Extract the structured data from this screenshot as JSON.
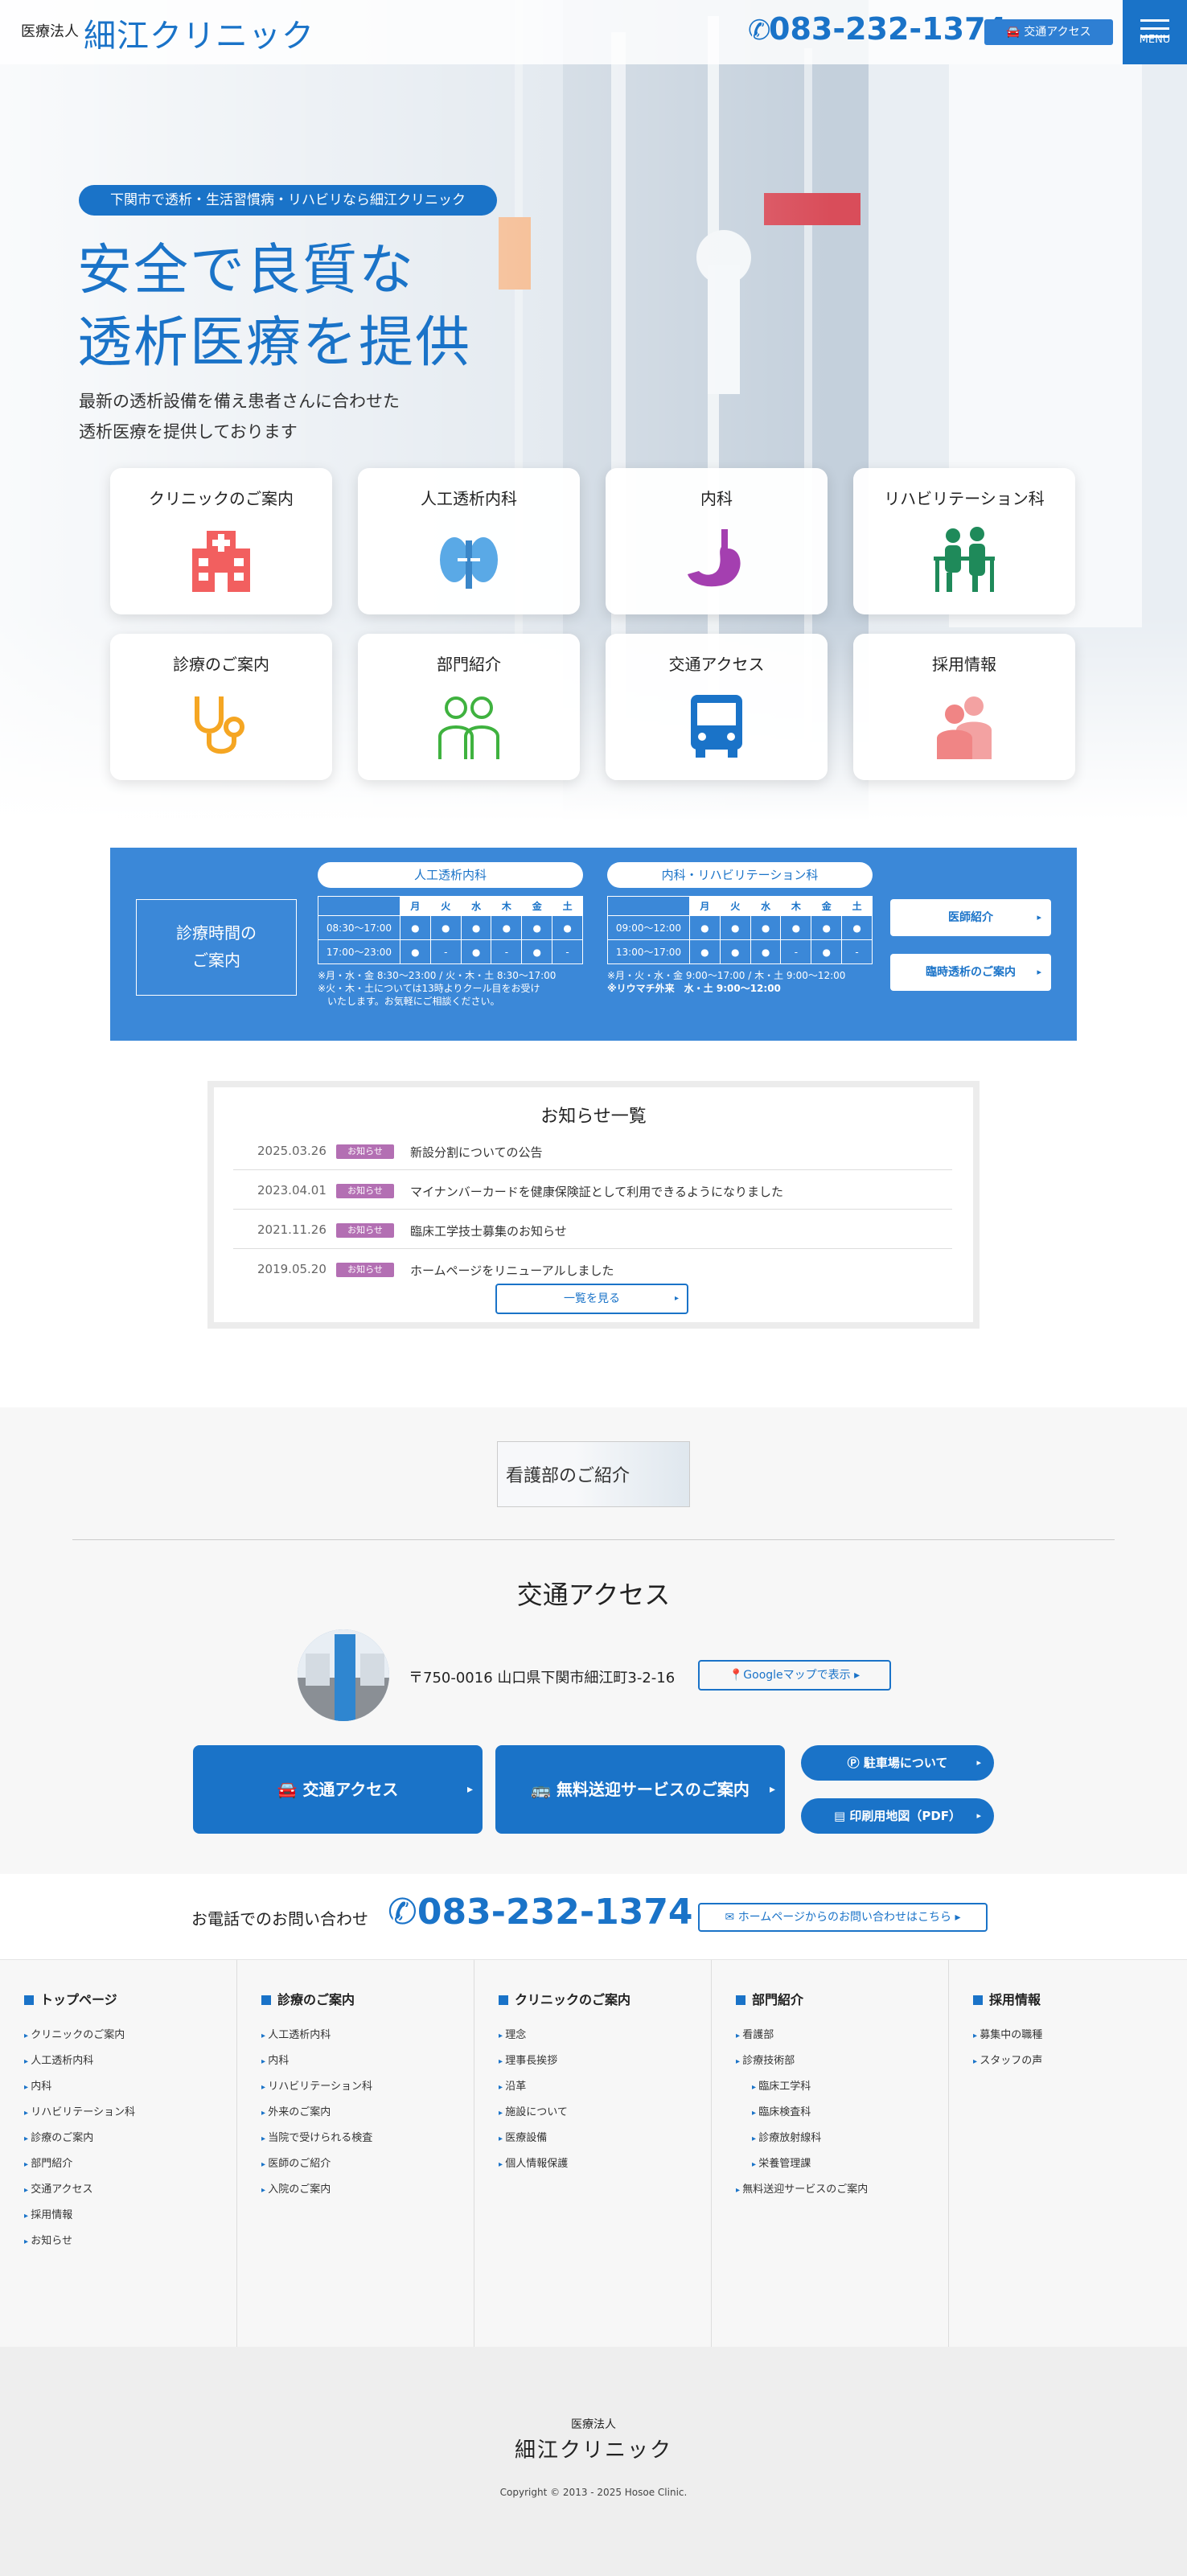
{
  "header": {
    "org_type": "医療法人",
    "clinic_name": "細江クリニック",
    "phone": "083-232-1374",
    "access_label": "交通アクセス",
    "menu_label": "MENU"
  },
  "hero": {
    "tag": "下関市で透析・生活習慣病・リハビリなら細江クリニック",
    "title_line1": "安全で良質な",
    "title_line2": "透析医療を提供",
    "sub_line1": "最新の透析設備を備え患者さんに合わせた",
    "sub_line2": "透析医療を提供しております"
  },
  "tiles": [
    {
      "label": "クリニックのご案内",
      "icon": "hospital-icon"
    },
    {
      "label": "人工透析内科",
      "icon": "kidney-icon"
    },
    {
      "label": "内科",
      "icon": "stomach-icon"
    },
    {
      "label": "リハビリテーション科",
      "icon": "rehabilitation-icon"
    },
    {
      "label": "診療のご案内",
      "icon": "stethoscope-icon"
    },
    {
      "label": "部門紹介",
      "icon": "staff-icon"
    },
    {
      "label": "交通アクセス",
      "icon": "bus-icon"
    },
    {
      "label": "採用情報",
      "icon": "recruit-icon"
    }
  ],
  "schedule": {
    "title_line1": "診療時間の",
    "title_line2": "ご案内",
    "days": [
      "月",
      "火",
      "水",
      "木",
      "金",
      "土"
    ],
    "dialysis": {
      "label": "人工透析内科",
      "rows": [
        {
          "time": "08:30〜17:00",
          "cells": [
            "●",
            "●",
            "●",
            "●",
            "●",
            "●"
          ]
        },
        {
          "time": "17:00〜23:00",
          "cells": [
            "●",
            "-",
            "●",
            "-",
            "●",
            "-"
          ]
        }
      ],
      "note1": "※月・水・金 8:30〜23:00 / 火・木・土 8:30〜17:00",
      "note2": "※火・木・土については13時よりクール目をお受け",
      "note3": "　いたします。お気軽にご相談ください。"
    },
    "internal": {
      "label": "内科・リハビリテーション科",
      "rows": [
        {
          "time": "09:00〜12:00",
          "cells": [
            "●",
            "●",
            "●",
            "●",
            "●",
            "●"
          ]
        },
        {
          "time": "13:00〜17:00",
          "cells": [
            "●",
            "●",
            "●",
            "-",
            "●",
            "-"
          ]
        }
      ],
      "note1": "※月・火・水・金 9:00〜17:00 / 木・土 9:00〜12:00",
      "note2": "※リウマチ外来　水・土 9:00〜12:00"
    },
    "btn_doctor": "医師紹介",
    "btn_temp": "臨時透析のご案内"
  },
  "news": {
    "title": "お知らせ一覧",
    "badge": "お知らせ",
    "items": [
      {
        "date": "2025.03.26",
        "text": "新設分割についての公告"
      },
      {
        "date": "2023.04.01",
        "text": "マイナンバーカードを健康保険証として利用できるようになりました"
      },
      {
        "date": "2021.11.26",
        "text": "臨床工学技士募集のお知らせ"
      },
      {
        "date": "2019.05.20",
        "text": "ホームページをリニューアルしました"
      }
    ],
    "more": "一覧を見る"
  },
  "nursing_banner": "看護部のご紹介",
  "access": {
    "title": "交通アクセス",
    "address": "〒750-0016 山口県下関市細江町3-2-16",
    "gmap": "Googleマップで表示",
    "btn_access": "交通アクセス",
    "btn_shuttle": "無料送迎サービスのご案内",
    "btn_parking": "駐車場について",
    "btn_map": "印刷用地図（PDF）"
  },
  "contact": {
    "label": "お電話でのお問い合わせ",
    "phone": "083-232-1374",
    "web": "ホームページからのお問い合わせはこちら"
  },
  "footer_nav": [
    {
      "title": "トップページ",
      "items": [
        {
          "t": "クリニックのご案内"
        },
        {
          "t": "人工透析内科"
        },
        {
          "t": "内科"
        },
        {
          "t": "リハビリテーション科"
        },
        {
          "t": "診療のご案内"
        },
        {
          "t": "部門紹介"
        },
        {
          "t": "交通アクセス"
        },
        {
          "t": "採用情報"
        },
        {
          "t": "お知らせ"
        }
      ]
    },
    {
      "title": "診療のご案内",
      "items": [
        {
          "t": "人工透析内科"
        },
        {
          "t": "内科"
        },
        {
          "t": "リハビリテーション科"
        },
        {
          "t": "外来のご案内"
        },
        {
          "t": "当院で受けられる検査"
        },
        {
          "t": "医師のご紹介"
        },
        {
          "t": "入院のご案内"
        }
      ]
    },
    {
      "title": "クリニックのご案内",
      "items": [
        {
          "t": "理念"
        },
        {
          "t": "理事長挨拶"
        },
        {
          "t": "沿革"
        },
        {
          "t": "施設について"
        },
        {
          "t": "医療設備"
        },
        {
          "t": "個人情報保護"
        }
      ]
    },
    {
      "title": "部門紹介",
      "items": [
        {
          "t": "看護部"
        },
        {
          "t": "診療技術部"
        },
        {
          "t": "臨床工学科",
          "sub": true
        },
        {
          "t": "臨床検査科",
          "sub": true
        },
        {
          "t": "診療放射線科",
          "sub": true
        },
        {
          "t": "栄養管理課",
          "sub": true
        },
        {
          "t": "無料送迎サービスのご案内"
        }
      ]
    },
    {
      "title": "採用情報",
      "items": [
        {
          "t": "募集中の職種"
        },
        {
          "t": "スタッフの声"
        }
      ]
    }
  ],
  "footer": {
    "org_type": "医療法人",
    "clinic_name": "細江クリニック",
    "copyright": "Copyright © 2013 - 2025 Hosoe Clinic."
  },
  "colors": {
    "brand": "#1a73c8",
    "schedule_bg": "#3b88d8",
    "news_badge": "#b36fb3"
  }
}
